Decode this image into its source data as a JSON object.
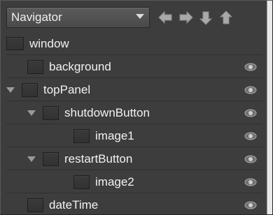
{
  "toolbar": {
    "selector_label": "Navigator",
    "nav_buttons": [
      {
        "name": "left-arrow-icon"
      },
      {
        "name": "right-arrow-icon"
      },
      {
        "name": "down-arrow-icon"
      },
      {
        "name": "up-arrow-icon"
      }
    ]
  },
  "tree": {
    "rows": [
      {
        "label": "window",
        "level": 0,
        "expandable": false,
        "visible_toggle": false
      },
      {
        "label": "background",
        "level": 1,
        "expandable": false,
        "visible_toggle": true
      },
      {
        "label": "topPanel",
        "level": 1,
        "expandable": true,
        "visible_toggle": true
      },
      {
        "label": "shutdownButton",
        "level": 2,
        "expandable": true,
        "visible_toggle": true
      },
      {
        "label": "image1",
        "level": 3,
        "expandable": false,
        "visible_toggle": true
      },
      {
        "label": "restartButton",
        "level": 2,
        "expandable": true,
        "visible_toggle": true
      },
      {
        "label": "image2",
        "level": 3,
        "expandable": false,
        "visible_toggle": true
      },
      {
        "label": "dateTime",
        "level": 1,
        "expandable": false,
        "visible_toggle": true
      }
    ]
  },
  "colors": {
    "panel_bg": "#3d3d3d",
    "text": "#f2f2f2",
    "icon_gray": "#a8a8a8"
  }
}
